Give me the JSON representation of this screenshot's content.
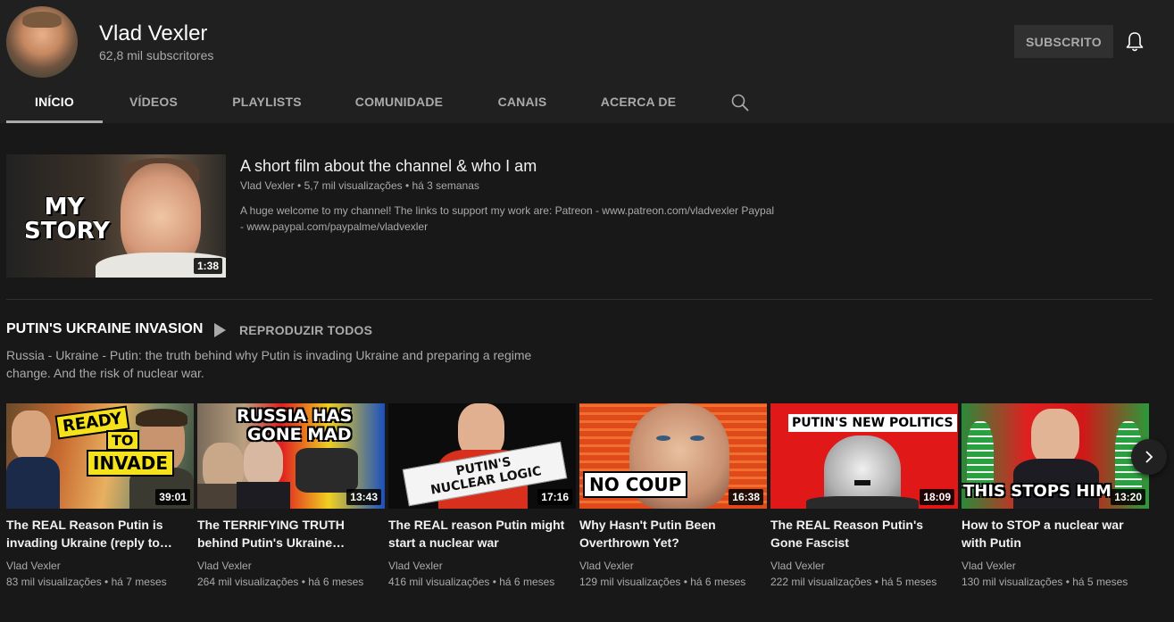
{
  "channel": {
    "name": "Vlad Vexler",
    "subscribers": "62,8 mil subscritores",
    "subscribe_label": "SUBSCRITO"
  },
  "tabs": [
    {
      "label": "INÍCIO"
    },
    {
      "label": "VÍDEOS"
    },
    {
      "label": "PLAYLISTS"
    },
    {
      "label": "COMUNIDADE"
    },
    {
      "label": "CANAIS"
    },
    {
      "label": "ACERCA DE"
    }
  ],
  "featured": {
    "thumb_text": "MY STORY",
    "duration": "1:38",
    "title": "A short film about the channel & who I am",
    "meta": "Vlad Vexler • 5,7 mil visualizações • há 3 semanas",
    "description": "A huge welcome to my channel! The links to support my work are: Patreon - www.patreon.com/vladvexler Paypal - www.paypal.com/paypalme/vladvexler"
  },
  "shelf": {
    "title": "PUTIN'S UKRAINE INVASION",
    "play_all": "REPRODUZIR TODOS",
    "description": "Russia - Ukraine - Putin: the truth behind why Putin is invading Ukraine and preparing a regime change. And the risk of nuclear war."
  },
  "videos": [
    {
      "thumb_text": [
        "READY",
        "TO",
        "INVADE"
      ],
      "duration": "39:01",
      "title": "The REAL Reason Putin is invading Ukraine (reply to…",
      "channel": "Vlad Vexler",
      "meta": "83 mil visualizações • há 7 meses"
    },
    {
      "thumb_text": [
        "RUSSIA HAS",
        "GONE MAD"
      ],
      "duration": "13:43",
      "title": "The TERRIFYING TRUTH behind Putin's Ukraine…",
      "channel": "Vlad Vexler",
      "meta": "264 mil visualizações • há 6 meses"
    },
    {
      "thumb_text": [
        "PUTIN'S",
        "NUCLEAR LOGIC"
      ],
      "duration": "17:16",
      "title": "The REAL reason Putin might start a nuclear war",
      "channel": "Vlad Vexler",
      "meta": "416 mil visualizações • há 6 meses"
    },
    {
      "thumb_text": [
        "NO COUP"
      ],
      "duration": "16:38",
      "title": "Why Hasn't Putin Been Overthrown Yet?",
      "channel": "Vlad Vexler",
      "meta": "129 mil visualizações • há 6 meses"
    },
    {
      "thumb_text": [
        "PUTIN'S NEW POLITICS"
      ],
      "duration": "18:09",
      "title": "The REAL Reason Putin's Gone Fascist",
      "channel": "Vlad Vexler",
      "meta": "222 mil visualizações • há 5 meses"
    },
    {
      "thumb_text": [
        "THIS STOPS HIM"
      ],
      "duration": "13:20",
      "title": "How to STOP a nuclear war with Putin",
      "channel": "Vlad Vexler",
      "meta": "130 mil visualizações • há 5 meses"
    }
  ],
  "colors": {
    "background": "#181818",
    "header": "#202020",
    "secondary_text": "#aaaaaa"
  },
  "icons": [
    "bell-icon",
    "search-icon",
    "play-icon",
    "chevron-right-icon"
  ]
}
